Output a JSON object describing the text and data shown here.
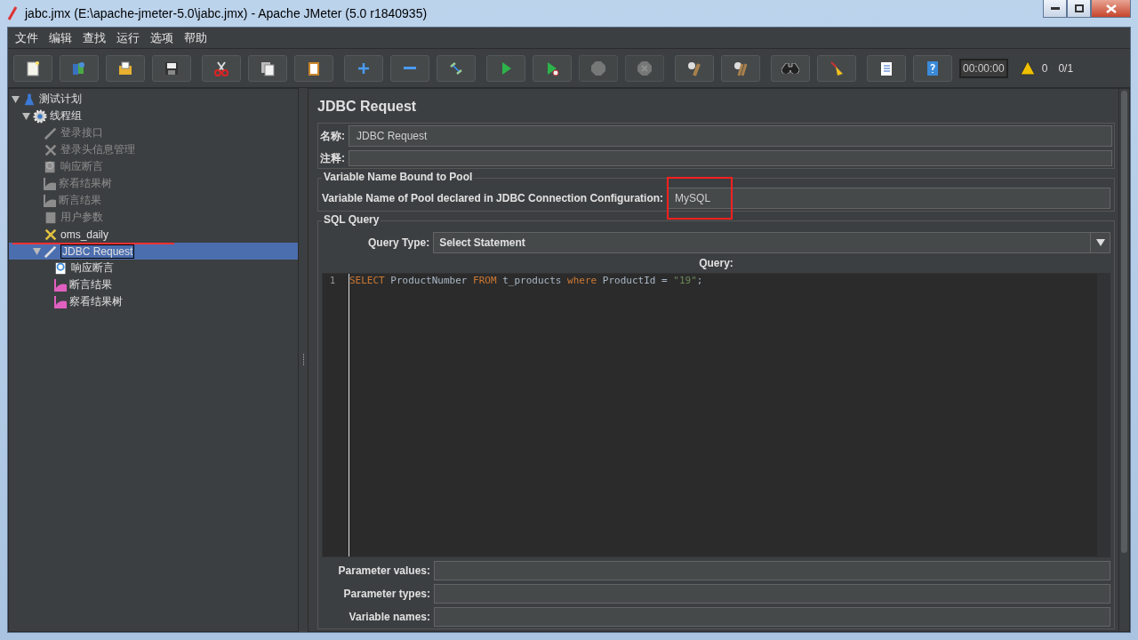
{
  "window": {
    "title": "jabc.jmx (E:\\apache-jmeter-5.0\\jabc.jmx) - Apache JMeter (5.0 r1840935)"
  },
  "menu": [
    "文件",
    "编辑",
    "查找",
    "运行",
    "选项",
    "帮助"
  ],
  "toolbar": {
    "groups": [
      [
        {
          "disabled": false
        },
        {
          "disabled": false
        },
        {
          "disabled": false
        },
        {
          "disabled": false
        }
      ],
      [
        {
          "disabled": false
        },
        {
          "disabled": false
        },
        {
          "disabled": false
        }
      ],
      [
        {
          "disabled": false
        },
        {
          "disabled": false
        },
        {
          "disabled": false
        }
      ],
      [
        {
          "disabled": false
        },
        {
          "disabled": false
        },
        {
          "disabled": true
        },
        {
          "disabled": true
        }
      ],
      [
        {
          "disabled": false
        },
        {
          "disabled": false
        }
      ],
      [
        {
          "disabled": false
        },
        {
          "disabled": false
        }
      ],
      [
        {
          "disabled": false
        },
        {
          "disabled": false
        }
      ]
    ],
    "timer": "00:00:00",
    "warnings": "0",
    "threads": "0/1"
  },
  "tree": [
    {
      "label": "测试计划",
      "kind": "plan",
      "expanded": true,
      "disabled": false,
      "selected": false,
      "children": [
        {
          "label": "线程组",
          "kind": "group",
          "expanded": true,
          "disabled": false,
          "selected": false,
          "children": [
            {
              "label": "登录接口",
              "kind": "sampler",
              "disabled": true,
              "selected": false
            },
            {
              "label": "登录头信息管理",
              "kind": "config",
              "disabled": true,
              "selected": false
            },
            {
              "label": "响应断言",
              "kind": "assertion",
              "disabled": true,
              "selected": false
            },
            {
              "label": "察看结果树",
              "kind": "listener",
              "disabled": true,
              "selected": false
            },
            {
              "label": "断言结果",
              "kind": "listener",
              "disabled": true,
              "selected": false
            },
            {
              "label": "用户参数",
              "kind": "preprocessor",
              "disabled": true,
              "selected": false
            },
            {
              "label": "oms_daily",
              "kind": "config",
              "disabled": false,
              "selected": false
            },
            {
              "label": "JDBC Request",
              "kind": "sampler",
              "expanded": true,
              "disabled": false,
              "selected": true,
              "children": [
                {
                  "label": "响应断言",
                  "kind": "assertion",
                  "disabled": false,
                  "selected": false
                },
                {
                  "label": "断言结果",
                  "kind": "listener",
                  "disabled": false,
                  "selected": false
                },
                {
                  "label": "察看结果树",
                  "kind": "listener",
                  "disabled": false,
                  "selected": false
                }
              ]
            }
          ]
        }
      ]
    }
  ],
  "panel": {
    "title": "JDBC Request",
    "name_label": "名称:",
    "name_value": "JDBC Request",
    "comment_label": "注释:",
    "pool": {
      "legend": "Variable Name Bound to Pool",
      "label": "Variable Name of Pool declared in JDBC Connection Configuration:",
      "value": "MySQL"
    },
    "sql": {
      "legend": "SQL Query",
      "query_type_label": "Query Type:",
      "query_type": "Select Statement",
      "query_label": "Query:",
      "lines": [
        {
          "number": "1",
          "tokens": [
            {
              "kind": "keyword",
              "text": "SELECT"
            },
            {
              "kind": "plain",
              "text": " ProductNumber "
            },
            {
              "kind": "keyword",
              "text": "FROM"
            },
            {
              "kind": "plain",
              "text": " t_products "
            },
            {
              "kind": "keyword",
              "text": "where"
            },
            {
              "kind": "plain",
              "text": " ProductId = "
            },
            {
              "kind": "string",
              "text": "\"19\""
            },
            {
              "kind": "plain",
              "text": ";"
            }
          ]
        }
      ],
      "params": [
        {
          "label": "Parameter values:"
        },
        {
          "label": "Parameter types:"
        },
        {
          "label": "Variable names:"
        }
      ]
    }
  }
}
